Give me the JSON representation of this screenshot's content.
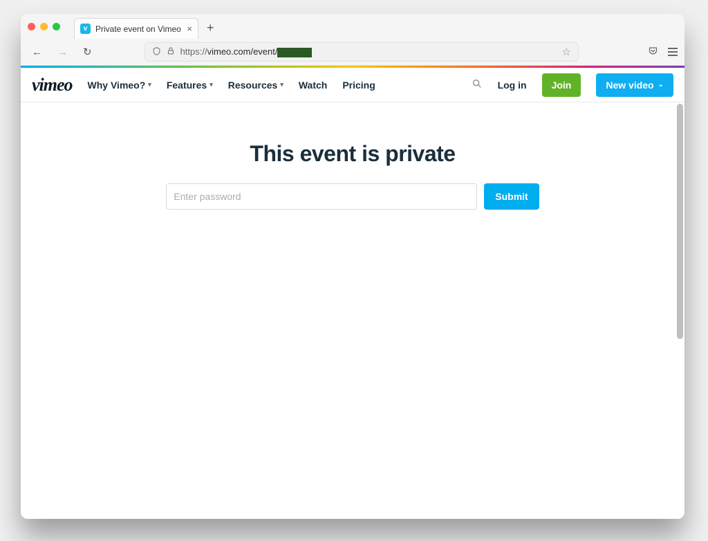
{
  "browser": {
    "tab_title": "Private event on Vimeo",
    "url_prefix": "https://",
    "url_host_path": "vimeo.com/event/"
  },
  "nav": {
    "logo": "vimeo",
    "why": "Why Vimeo?",
    "features": "Features",
    "resources": "Resources",
    "watch": "Watch",
    "pricing": "Pricing",
    "login": "Log in",
    "join": "Join",
    "new_video": "New video"
  },
  "page": {
    "title": "This event is private",
    "password_placeholder": "Enter password",
    "submit": "Submit"
  }
}
